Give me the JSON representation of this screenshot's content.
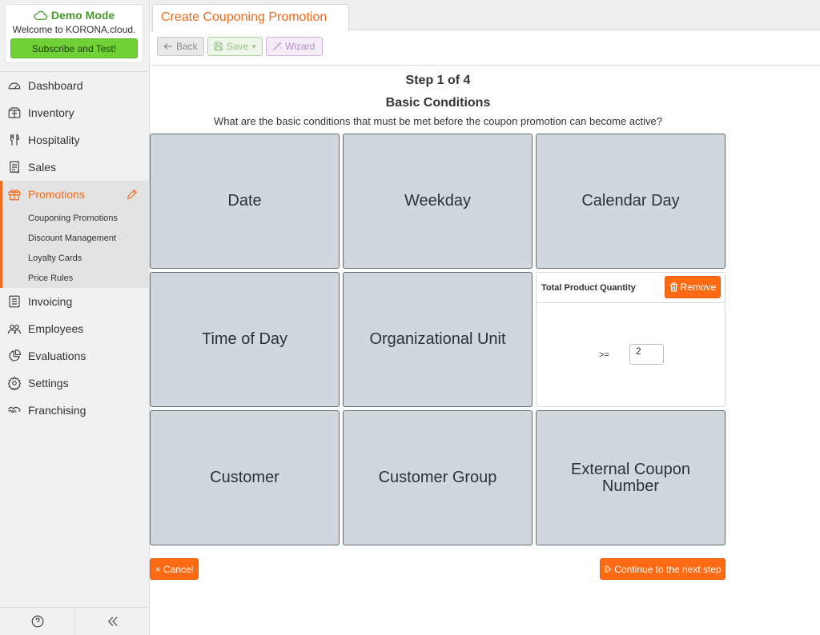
{
  "demo": {
    "title": "Demo Mode",
    "welcome": "Welcome to KORONA.cloud.",
    "subscribe_label": "Subscribe and Test!"
  },
  "nav": {
    "dashboard": "Dashboard",
    "inventory": "Inventory",
    "hospitality": "Hospitality",
    "sales": "Sales",
    "promotions": "Promotions",
    "promotions_sub": [
      "Couponing Promotions",
      "Discount Management",
      "Loyalty Cards",
      "Price Rules"
    ],
    "invoicing": "Invoicing",
    "employees": "Employees",
    "evaluations": "Evaluations",
    "settings": "Settings",
    "franchising": "Franchising"
  },
  "header": {
    "tab_title": "Create Couponing Promotion",
    "back_label": "Back",
    "save_label": "Save",
    "wizard_label": "Wizard"
  },
  "wizard": {
    "step": "Step 1 of 4",
    "section_title": "Basic Conditions",
    "description": "What are the basic conditions that must be met before the coupon promotion can become active?"
  },
  "tiles": {
    "date": "Date",
    "weekday": "Weekday",
    "calendar_day": "Calendar Day",
    "time_of_day": "Time of Day",
    "organizational_unit": "Organizational Unit",
    "customer": "Customer",
    "customer_group": "Customer Group",
    "external_coupon_number": "External Coupon Number"
  },
  "quantity_panel": {
    "title": "Total Product Quantity",
    "remove_label": "Remove",
    "operator": ">=",
    "value": "2"
  },
  "footer": {
    "cancel_label": "× Cancel",
    "next_label": "Continue to the next step"
  },
  "colors": {
    "accent": "#f26a1b",
    "button_orange": "#ff6a13",
    "tile_bg": "#d0d8dd",
    "subscribe_green": "#6fd135",
    "demo_green": "#4a9a2e"
  }
}
